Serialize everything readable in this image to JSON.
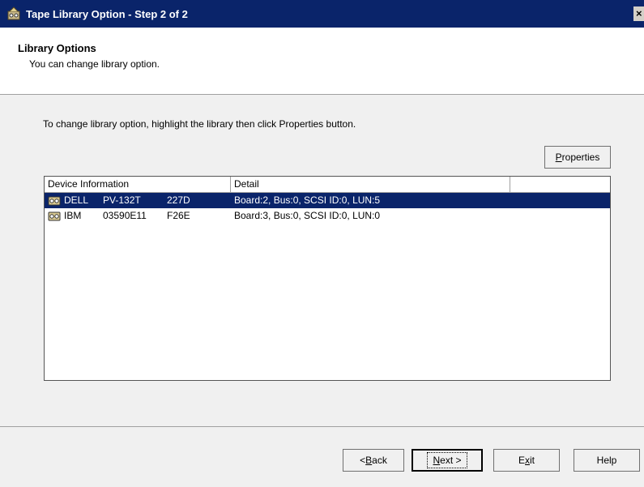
{
  "window": {
    "title": "Tape Library Option - Step 2 of 2",
    "close_label": "×"
  },
  "header": {
    "title": "Library Options",
    "subtitle": "You can change library option."
  },
  "main": {
    "instructions": "To change library option, highlight the library then click Properties button.",
    "properties_button": {
      "prefix": "",
      "accel": "P",
      "rest": "roperties"
    }
  },
  "list": {
    "columns": [
      "Device Information",
      "Detail",
      ""
    ],
    "rows": [
      {
        "vendor": "DELL",
        "model": "PV-132T",
        "rev": "227D",
        "detail": "Board:2, Bus:0, SCSI ID:0, LUN:5",
        "selected": true
      },
      {
        "vendor": "IBM",
        "model": "03590E11",
        "rev": "F26E",
        "detail": "Board:3, Bus:0, SCSI ID:0, LUN:0",
        "selected": false
      }
    ]
  },
  "footer": {
    "back": {
      "prefix": "< ",
      "accel": "B",
      "rest": "ack"
    },
    "next": {
      "prefix": "",
      "accel": "N",
      "rest": "ext >"
    },
    "exit": {
      "prefix": "E",
      "accel": "x",
      "rest": "it"
    },
    "help": "Help"
  },
  "colors": {
    "titlebar": "#0a246a",
    "selection": "#0a246a",
    "dialog_bg": "#f0f0f0"
  },
  "icons": {
    "app": "tape-library-icon",
    "row": "tape-device-icon"
  }
}
